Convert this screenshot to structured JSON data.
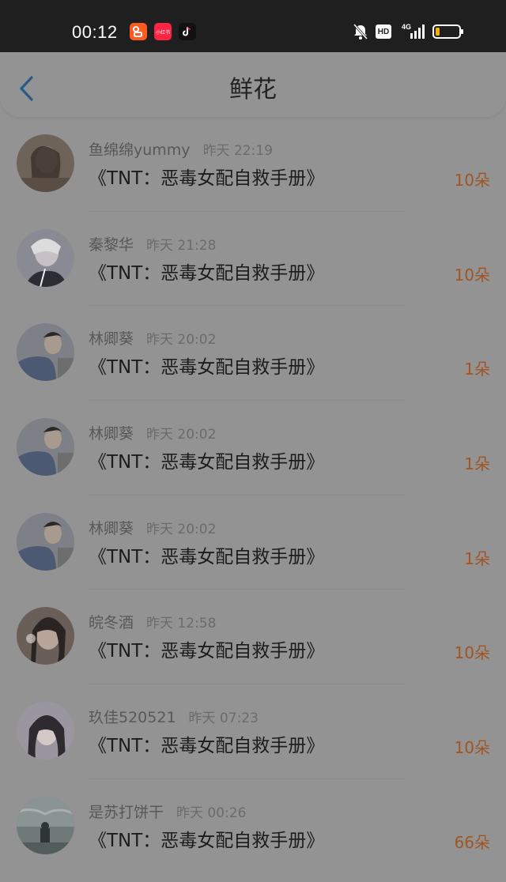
{
  "status_bar": {
    "time": "00:12",
    "apps": [
      "kuaishou-icon",
      "xiaohongshu-icon",
      "douyin-icon"
    ],
    "xhs_label": "小红书",
    "icons": [
      "mute-bell-icon",
      "hd-icon",
      "signal-4g-icon",
      "battery-icon"
    ],
    "hd_label": "HD",
    "network": "4G"
  },
  "nav": {
    "title": "鲜花",
    "back_icon": "chevron-left-icon"
  },
  "flowers": [
    {
      "name": "鱼绵绵yummy",
      "time": "昨天 22:19",
      "book": "《TNT：恶毒女配自救手册》",
      "count": "10朵",
      "avatar_color": "#5a4a40"
    },
    {
      "name": "秦黎华",
      "time": "昨天 21:28",
      "book": "《TNT：恶毒女配自救手册》",
      "count": "10朵",
      "avatar_color": "#7a7a86"
    },
    {
      "name": "林卿葵",
      "time": "昨天 20:02",
      "book": "《TNT：恶毒女配自救手册》",
      "count": "1朵",
      "avatar_color": "#556070"
    },
    {
      "name": "林卿葵",
      "time": "昨天 20:02",
      "book": "《TNT：恶毒女配自救手册》",
      "count": "1朵",
      "avatar_color": "#556070"
    },
    {
      "name": "林卿葵",
      "time": "昨天 20:02",
      "book": "《TNT：恶毒女配自救手册》",
      "count": "1朵",
      "avatar_color": "#556070"
    },
    {
      "name": "皖冬酒",
      "time": "昨天 12:58",
      "book": "《TNT：恶毒女配自救手册》",
      "count": "10朵",
      "avatar_color": "#6a5a55"
    },
    {
      "name": "玖佳520521",
      "time": "昨天 07:23",
      "book": "《TNT：恶毒女配自救手册》",
      "count": "10朵",
      "avatar_color": "#8a8592"
    },
    {
      "name": "是苏打饼干",
      "time": "昨天 00:26",
      "book": "《TNT：恶毒女配自救手册》",
      "count": "66朵",
      "avatar_color": "#5d6a68"
    }
  ],
  "colors": {
    "accent_count": "#a05522",
    "back_chevron": "#2a5a86",
    "overlay_bg": "#939393"
  }
}
